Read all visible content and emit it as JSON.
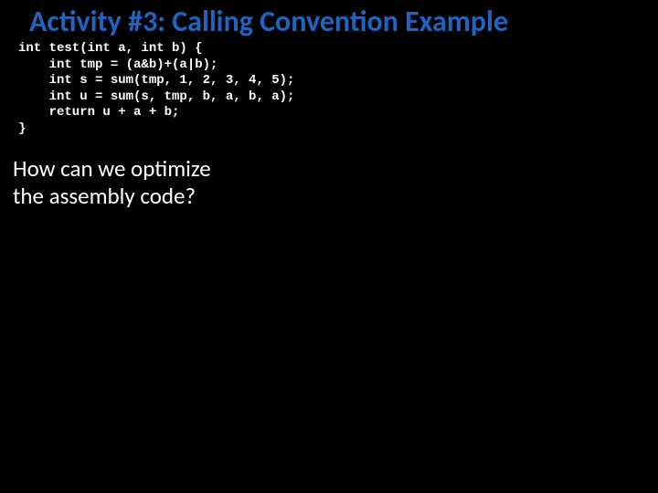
{
  "title": "Activity #3: Calling Convention Example",
  "code": {
    "l1": "int test(int a, int b) {",
    "l2": "    int tmp = (a&b)+(a|b);",
    "l3": "    int s = sum(tmp, 1, 2, 3, 4, 5);",
    "l4": "    int u = sum(s, tmp, b, a, b, a);",
    "l5": "    return u + a + b;",
    "l6": "}"
  },
  "question": {
    "l1": "How can we optimize",
    "l2": "the assembly code?"
  }
}
